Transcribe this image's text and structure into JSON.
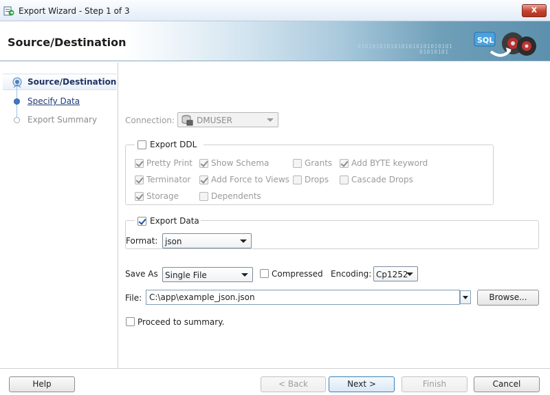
{
  "window": {
    "title": "Export Wizard - Step 1 of 3",
    "close_label": "x"
  },
  "banner": {
    "title": "Source/Destination",
    "binary_line1": "01010101010101010101010101",
    "binary_line2": "01010101"
  },
  "steps": [
    {
      "label": "Source/Destination",
      "state": "active"
    },
    {
      "label": "Specify Data",
      "state": "link"
    },
    {
      "label": "Export Summary",
      "state": "disabled"
    }
  ],
  "connection": {
    "label": "Connection:",
    "value": "DMUSER"
  },
  "export_ddl": {
    "label": "Export DDL",
    "checked": false,
    "options": {
      "pretty_print": "Pretty Print",
      "show_schema": "Show Schema",
      "grants": "Grants",
      "add_byte_keyword": "Add BYTE keyword",
      "terminator": "Terminator",
      "add_force_to_views": "Add Force to Views",
      "drops": "Drops",
      "cascade_drops": "Cascade Drops",
      "storage": "Storage",
      "dependents": "Dependents"
    }
  },
  "export_data": {
    "label": "Export Data",
    "checked": true,
    "format_label": "Format:",
    "format_value": "json"
  },
  "save": {
    "save_as_label": "Save As",
    "save_as_value": "Single File",
    "compressed_label": "Compressed",
    "encoding_label": "Encoding:",
    "encoding_value": "Cp1252",
    "file_label": "File:",
    "file_value": "C:\\app\\example_json.json",
    "browse_label": "Browse..."
  },
  "proceed_label": "Proceed to summary.",
  "footer": {
    "help": "Help",
    "back": "< Back",
    "next": "Next >",
    "finish": "Finish",
    "cancel": "Cancel"
  }
}
